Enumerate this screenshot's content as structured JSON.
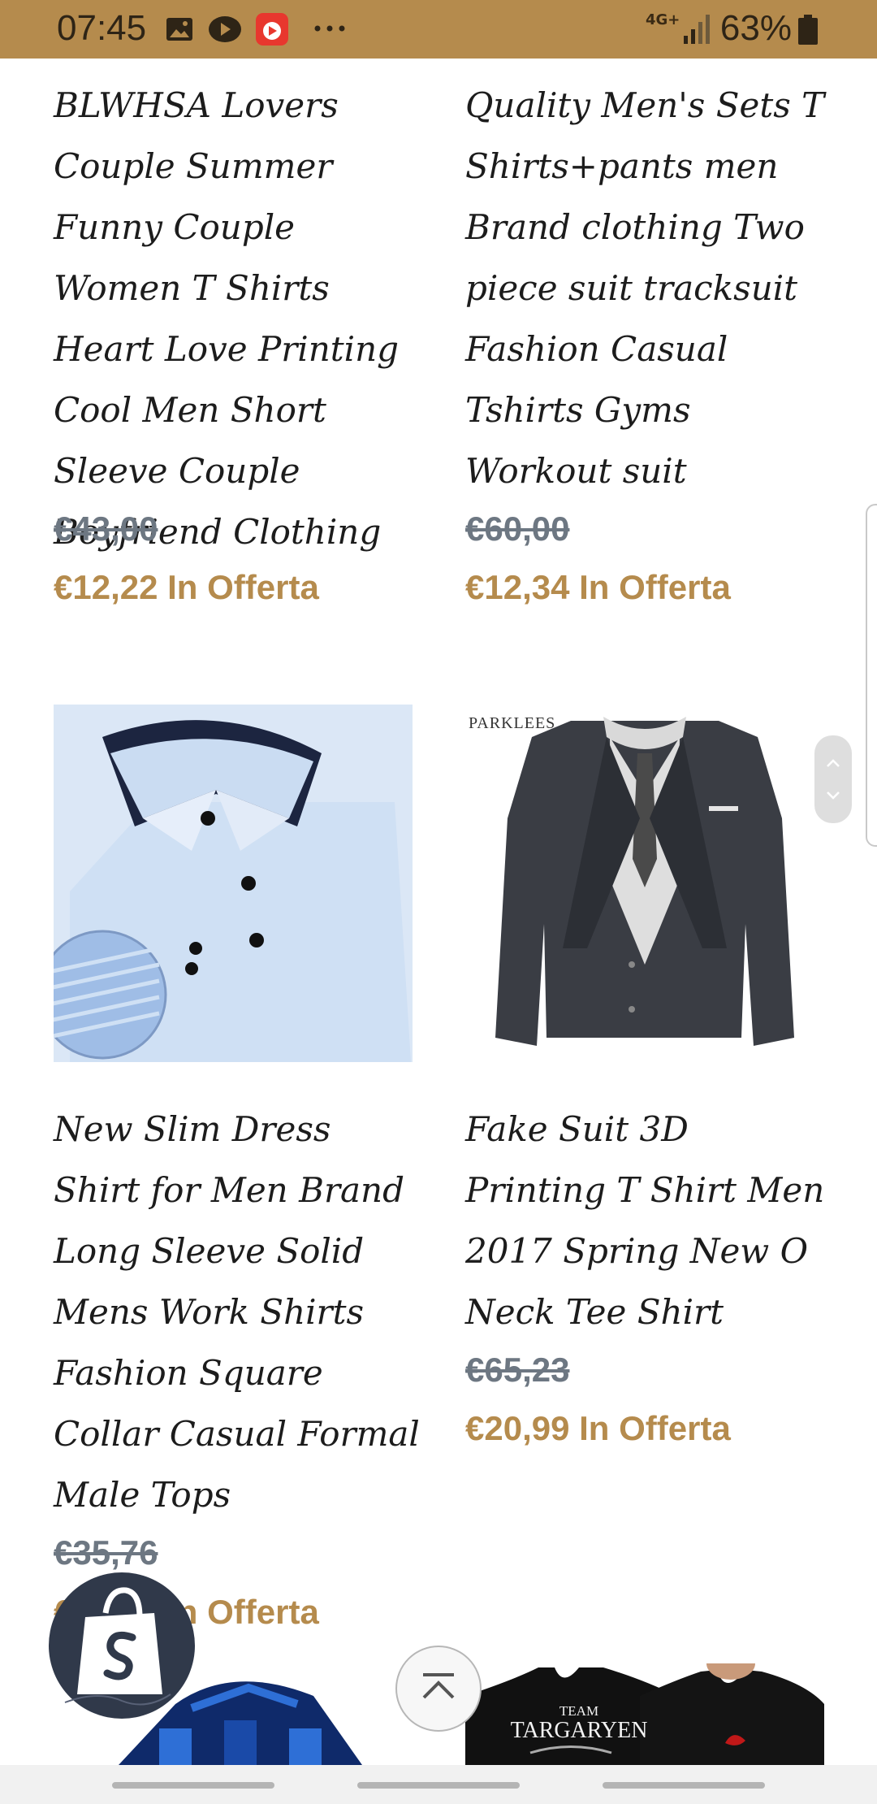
{
  "status_bar": {
    "time": "07:45",
    "network": "4G+",
    "battery": "63%",
    "icons": [
      "image-icon",
      "video-icon",
      "app-icon",
      "more-icon",
      "signal-icon",
      "battery-icon"
    ],
    "colors": {
      "background": "#b58b4d"
    }
  },
  "products": [
    {
      "title": "BLWHSA Lovers Couple Summer Funny Couple Women T Shirts Heart Love Printing Cool Men Short Sleeve Couple Boyfriend Clothing",
      "old_price": "€43,00",
      "sale_price": "€12,22 In Offerta"
    },
    {
      "title": "Quality Men's Sets T Shirts+pants men Brand clothing Two piece suit tracksuit Fashion Casual Tshirts Gyms Workout suit",
      "old_price": "€60,00",
      "sale_price": "€12,34 In Offerta"
    },
    {
      "title": "New Slim Dress Shirt for Men Brand Long Sleeve Solid Mens Work Shirts Fashion Square Collar Casual Formal Male Tops",
      "old_price": "€35,76",
      "sale_price": "€17,99 In Offerta"
    },
    {
      "title": "Fake Suit 3D Printing T Shirt Men 2017 Spring New O Neck Tee Shirt",
      "old_price": "€65,23",
      "sale_price": "€20,99 In Offerta",
      "image_label": "PARKLEES"
    },
    {
      "image_text": [
        "TEAM",
        "TARGARYEN"
      ]
    }
  ],
  "colors": {
    "accent": "#b58b4d",
    "old_price": "#6d7782",
    "text": "#1c1c1c"
  }
}
